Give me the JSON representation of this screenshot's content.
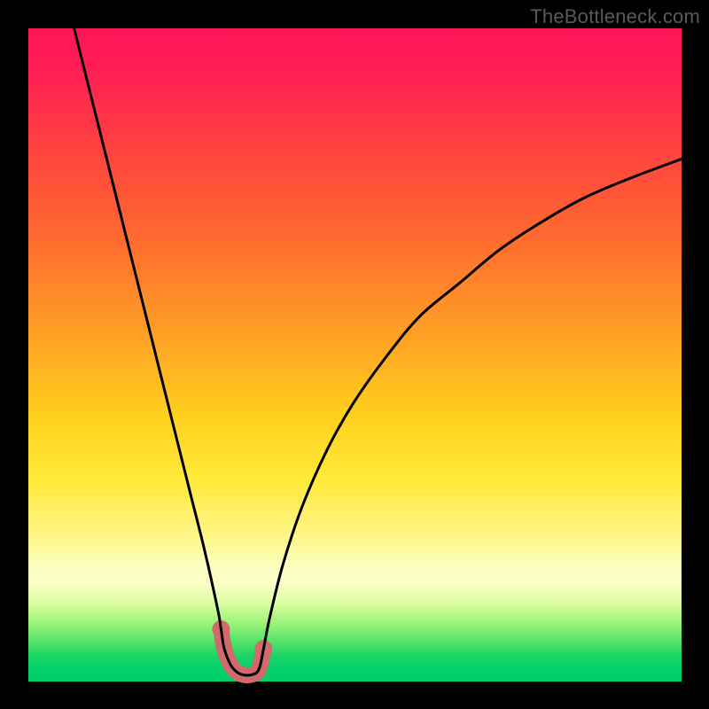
{
  "watermark": "TheBottleneck.com",
  "chart_data": {
    "type": "line",
    "title": "",
    "xlabel": "",
    "ylabel": "",
    "xlim": [
      0,
      100
    ],
    "ylim": [
      0,
      100
    ],
    "series": [
      {
        "name": "bottleneck-curve",
        "x": [
          7,
          9,
          11,
          13,
          15,
          17,
          19,
          21,
          23,
          25,
          27,
          29,
          29.5,
          30,
          31,
          32,
          33,
          34,
          35,
          35.5,
          36,
          37,
          39,
          42,
          46,
          50,
          55,
          60,
          66,
          72,
          78,
          85,
          92,
          100
        ],
        "y": [
          100,
          92,
          84,
          76,
          68,
          60,
          52,
          44,
          36,
          28,
          20,
          11,
          8,
          5,
          2.5,
          1.4,
          1,
          1,
          1.4,
          2.5,
          5,
          10,
          18,
          27,
          36,
          43,
          50,
          56,
          61,
          66,
          70,
          74,
          77,
          80
        ],
        "color": "#000000",
        "line_width": 3
      }
    ],
    "highlight_segment": {
      "name": "bottleneck-minimum-marker",
      "color": "#d16a6a",
      "points": [
        {
          "x": 29.5,
          "y": 8
        },
        {
          "x": 30,
          "y": 5
        },
        {
          "x": 31,
          "y": 2.5
        },
        {
          "x": 32,
          "y": 1.4
        },
        {
          "x": 33,
          "y": 1
        },
        {
          "x": 34,
          "y": 1
        },
        {
          "x": 35,
          "y": 1.4
        },
        {
          "x": 35.5,
          "y": 2.5
        },
        {
          "x": 36,
          "y": 5
        }
      ],
      "line_width": 18,
      "endpoint_radius": 10
    }
  }
}
